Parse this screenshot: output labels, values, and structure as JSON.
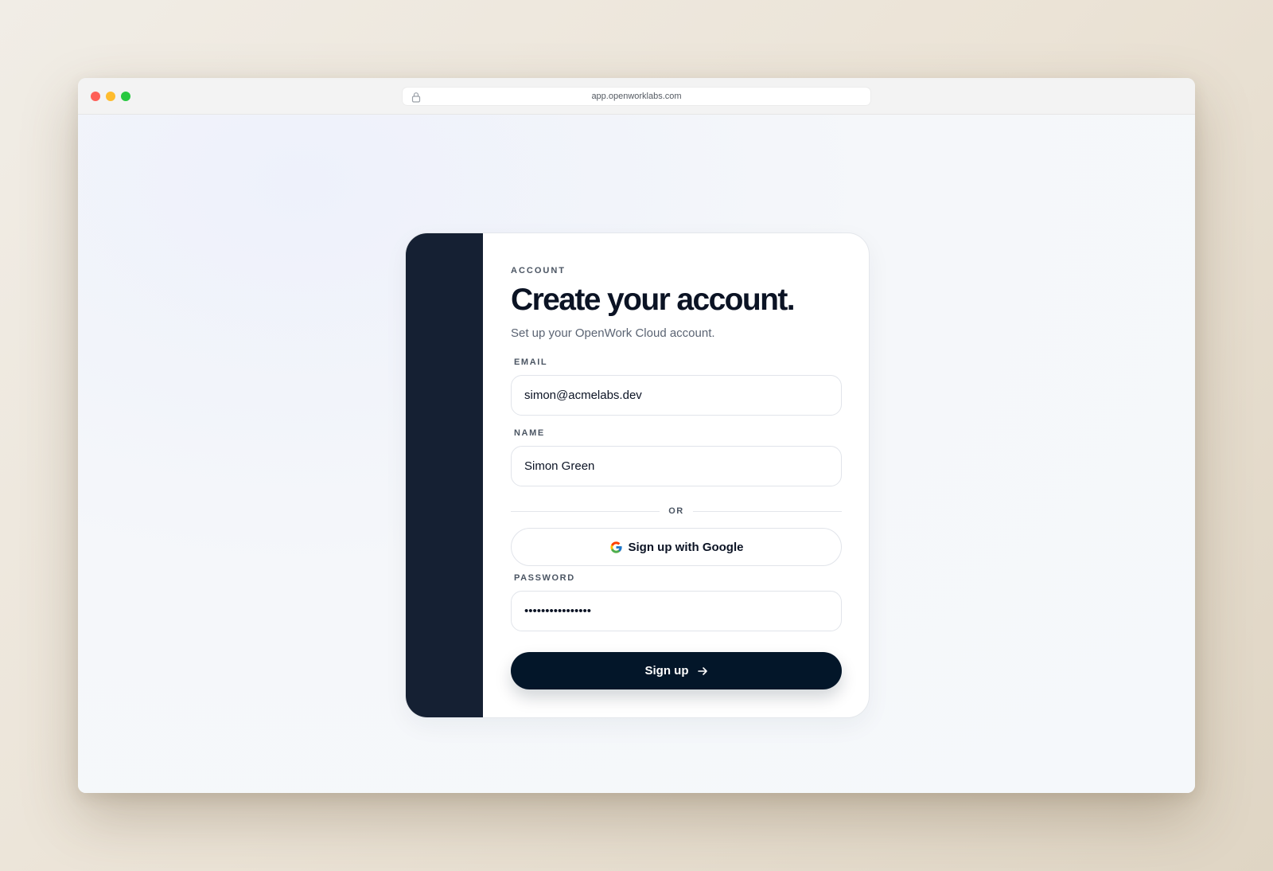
{
  "browser": {
    "url": "app.openworklabs.com"
  },
  "form": {
    "eyebrow": "ACCOUNT",
    "title": "Create your account.",
    "subtitle": "Set up your OpenWork Cloud account.",
    "email": {
      "label": "EMAIL",
      "value": "simon@acmelabs.dev"
    },
    "name": {
      "label": "NAME",
      "value": "Simon Green"
    },
    "divider_text": "OR",
    "google_button": {
      "label": "Sign up with Google",
      "icon": "google-icon"
    },
    "password": {
      "label": "PASSWORD",
      "value": "••••••••••••••••"
    },
    "submit_button": {
      "label": "Sign up",
      "icon": "arrow-right-icon"
    }
  },
  "colors": {
    "panel": "#152033",
    "primary_button": "#031629",
    "heading": "#0b1324"
  }
}
